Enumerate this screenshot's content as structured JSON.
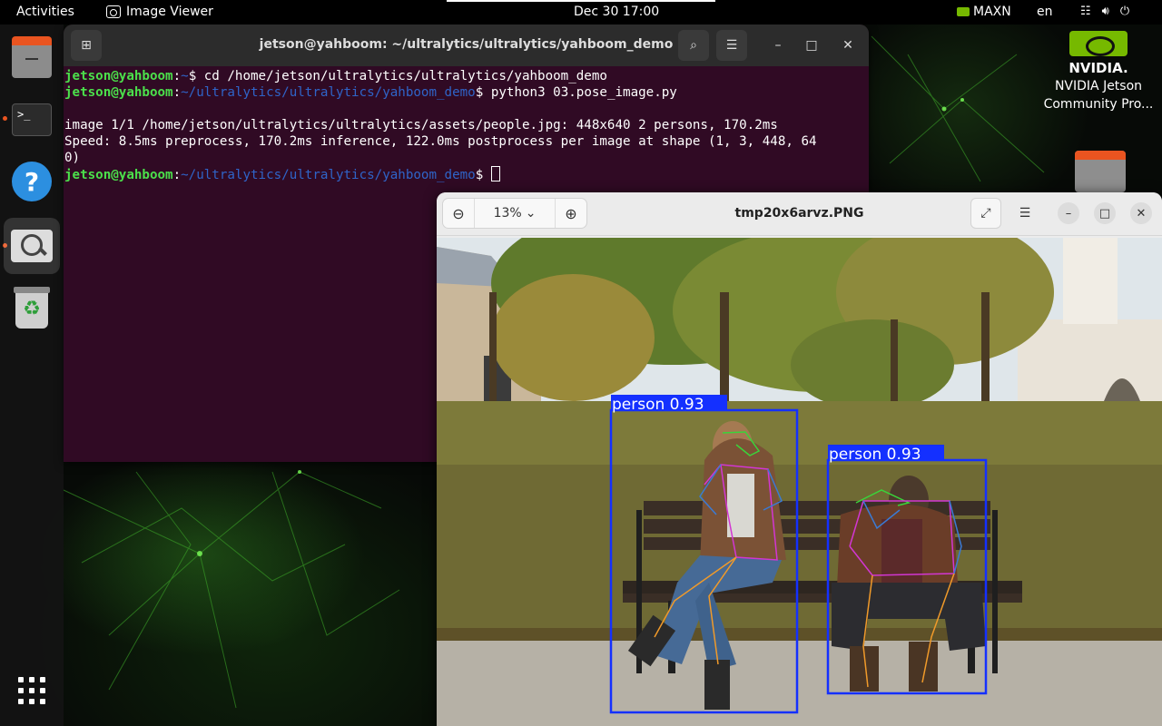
{
  "topbar": {
    "activities": "Activities",
    "app_name": "Image Viewer",
    "clock": "Dec 30  17:00",
    "power_mode": "MAXN",
    "language": "en"
  },
  "dock": {
    "items": [
      "files",
      "terminal",
      "help",
      "image-viewer",
      "trash",
      "show-applications"
    ]
  },
  "desktop": {
    "nvidia_brand": "NVIDIA.",
    "nvidia_label_1": "NVIDIA Jetson",
    "nvidia_label_2": "Community Pro..."
  },
  "terminal": {
    "title": "jetson@yahboom: ~/ultralytics/ultralytics/yahboom_demo",
    "lines": [
      {
        "user": "jetson@yahboom",
        "sep": ":",
        "path": "~",
        "cmd": "$ cd /home/jetson/ultralytics/ultralytics/yahboom_demo"
      },
      {
        "user": "jetson@yahboom",
        "sep": ":",
        "path": "~/ultralytics/ultralytics/yahboom_demo",
        "cmd": "$ python3 03.pose_image.py"
      },
      {
        "text": ""
      },
      {
        "text": "image 1/1 /home/jetson/ultralytics/ultralytics/assets/people.jpg: 448x640 2 persons, 170.2ms"
      },
      {
        "text": "Speed: 8.5ms preprocess, 170.2ms inference, 122.0ms postprocess per image at shape (1, 3, 448, 64"
      },
      {
        "text": "0)"
      },
      {
        "user": "jetson@yahboom",
        "sep": ":",
        "path": "~/ultralytics/ultralytics/yahboom_demo",
        "cmd": "$ "
      }
    ]
  },
  "viewer": {
    "title": "tmp20x6arvz.PNG",
    "zoom": "13%",
    "detections": [
      {
        "label": "person 0.93"
      },
      {
        "label": "person 0.93"
      }
    ]
  },
  "colors": {
    "terminal_bg": "#300a24",
    "prompt_user": "#4be04b",
    "prompt_path": "#2f64c8",
    "bbox": "#1430ff",
    "accent": "#e95420",
    "nvidia": "#76b900"
  }
}
